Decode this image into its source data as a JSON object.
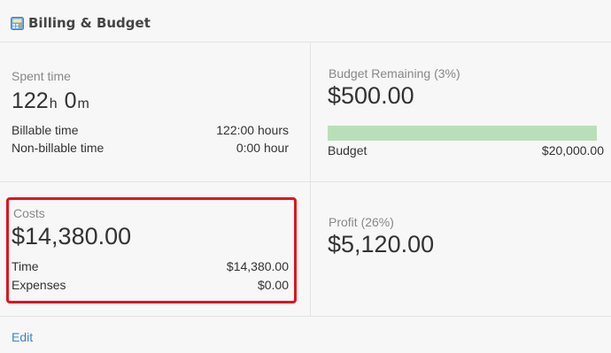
{
  "header": {
    "title": "Billing & Budget",
    "icon": "calculator-icon"
  },
  "spent_time": {
    "label": "Spent time",
    "hours_value": "122",
    "hours_unit": "h",
    "minutes_value": "0",
    "minutes_unit": "m",
    "billable_label": "Billable time",
    "billable_value": "122:00 hours",
    "nonbillable_label": "Non-billable time",
    "nonbillable_value": "0:00 hour"
  },
  "budget": {
    "label": "Budget Remaining (3%)",
    "amount": "$500.00",
    "remaining_fraction": 1.0,
    "bar_color": "#b9dfb8",
    "budget_label": "Budget",
    "budget_value": "$20,000.00"
  },
  "costs": {
    "label": "Costs",
    "amount": "$14,380.00",
    "time_label": "Time",
    "time_value": "$14,380.00",
    "expenses_label": "Expenses",
    "expenses_value": "$0.00",
    "highlight_color": "#e0141e"
  },
  "profit": {
    "label": "Profit (26%)",
    "amount": "$5,120.00"
  },
  "footer": {
    "edit_label": "Edit"
  }
}
